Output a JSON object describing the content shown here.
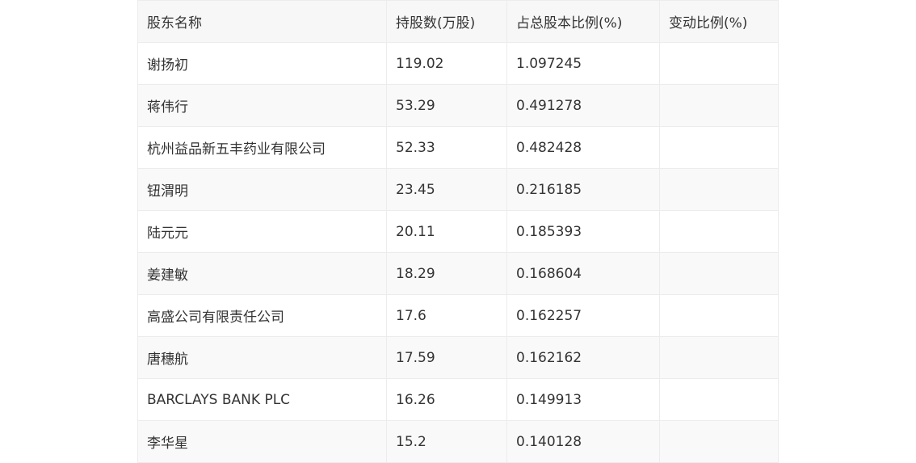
{
  "table": {
    "headers": [
      "股东名称",
      "持股数(万股)",
      "占总股本比例(%)",
      "变动比例(%)"
    ],
    "rows": [
      [
        "谢扬初",
        "119.02",
        "1.097245",
        ""
      ],
      [
        "蒋伟行",
        "53.29",
        "0.491278",
        ""
      ],
      [
        "杭州益品新五丰药业有限公司",
        "52.33",
        "0.482428",
        ""
      ],
      [
        "钮渭明",
        "23.45",
        "0.216185",
        ""
      ],
      [
        "陆元元",
        "20.11",
        "0.185393",
        ""
      ],
      [
        "姜建敏",
        "18.29",
        "0.168604",
        ""
      ],
      [
        "高盛公司有限责任公司",
        "17.6",
        "0.162257",
        ""
      ],
      [
        "唐穗航",
        "17.59",
        "0.162162",
        ""
      ],
      [
        "BARCLAYS BANK PLC",
        "16.26",
        "0.149913",
        ""
      ],
      [
        "李华星",
        "15.2",
        "0.140128",
        ""
      ]
    ]
  }
}
